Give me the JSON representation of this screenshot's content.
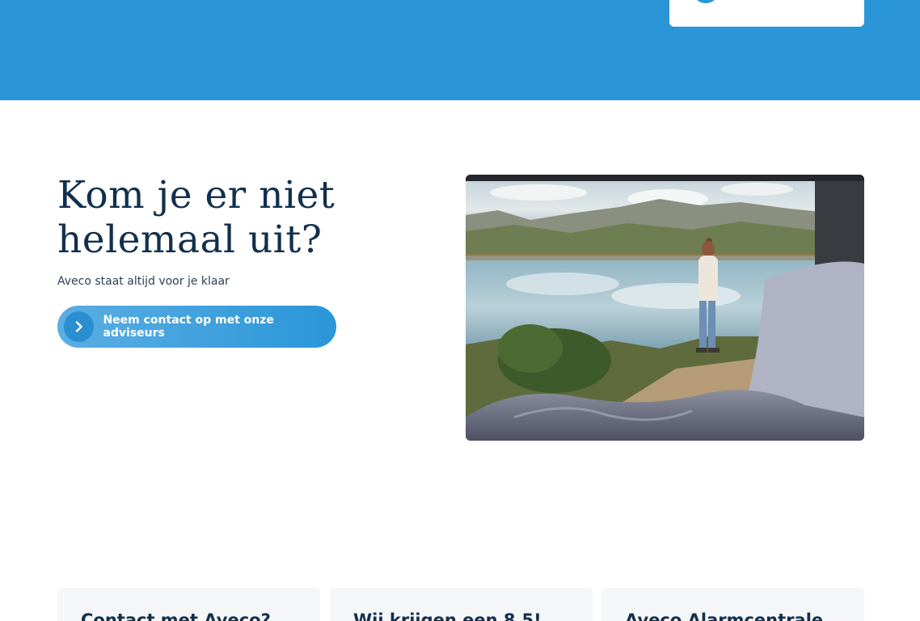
{
  "hero": {
    "title_line1": "Kom je er niet",
    "title_line2": "helemaal uit?",
    "subtitle": "Aveco staat altijd voor je klaar",
    "cta_label": "Neem contact op met onze adviseurs"
  },
  "cards": [
    {
      "title": "Contact met Aveco?"
    },
    {
      "title": "Wij krijgen een 8,5!"
    },
    {
      "title": "Aveco Alarmcentrale"
    }
  ],
  "icons": {
    "cta": "chevron-right-icon"
  },
  "colors": {
    "brand_blue": "#2a96d8",
    "heading": "#12304d",
    "card_bg": "#f5f6f8"
  }
}
